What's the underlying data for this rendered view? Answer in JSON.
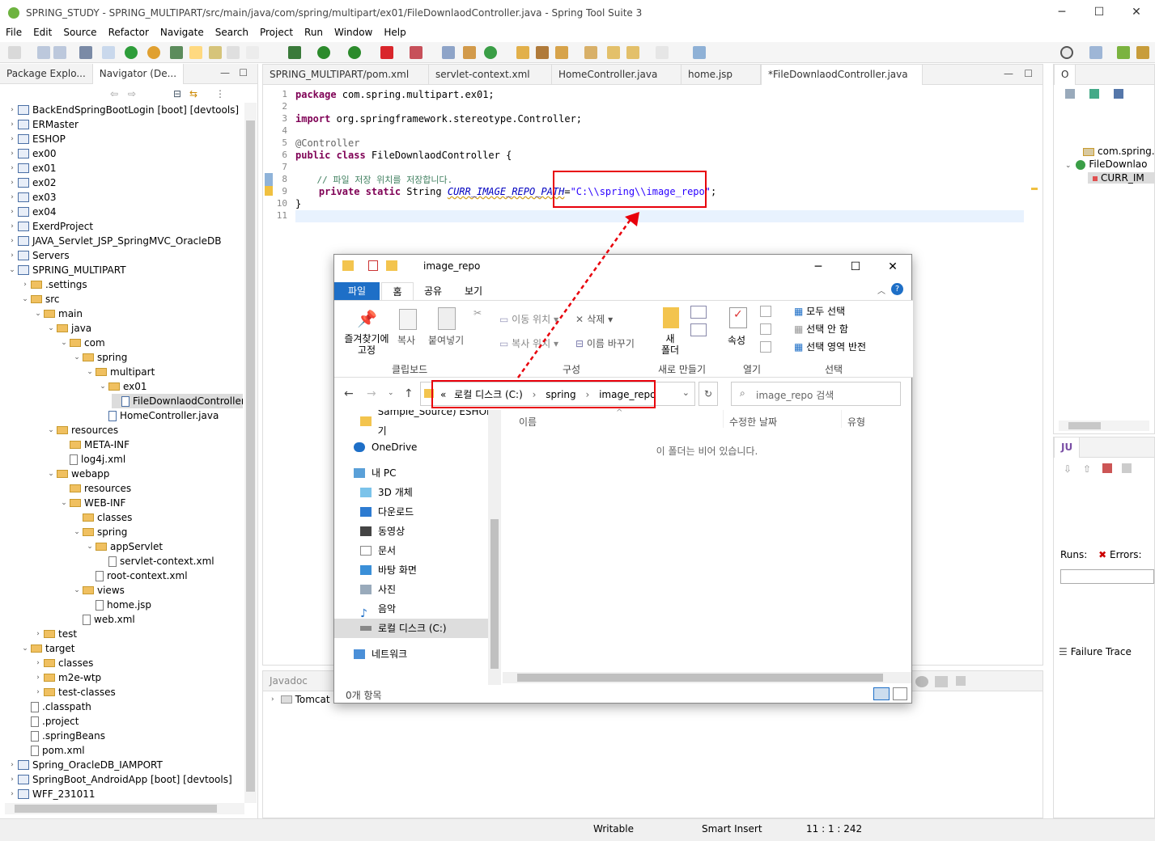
{
  "window": {
    "title": "SPRING_STUDY - SPRING_MULTIPART/src/main/java/com/spring/multipart/ex01/FileDownlaodController.java - Spring Tool Suite 3",
    "min": "─",
    "max": "☐",
    "close": "✕"
  },
  "menu": [
    "File",
    "Edit",
    "Source",
    "Refactor",
    "Navigate",
    "Search",
    "Project",
    "Run",
    "Window",
    "Help"
  ],
  "left_panel": {
    "tabs": [
      "Package Explo...",
      "Navigator (De..."
    ]
  },
  "tree": [
    {
      "l": "BackEndSpringBootLogin [boot] [devtools]",
      "d": 0,
      "t": "proj",
      "tw": "›"
    },
    {
      "l": "ERMaster",
      "d": 0,
      "t": "proj",
      "tw": "›"
    },
    {
      "l": "ESHOP",
      "d": 0,
      "t": "proj",
      "tw": "›"
    },
    {
      "l": "ex00",
      "d": 0,
      "t": "proj",
      "tw": "›"
    },
    {
      "l": "ex01",
      "d": 0,
      "t": "proj",
      "tw": "›"
    },
    {
      "l": "ex02",
      "d": 0,
      "t": "proj",
      "tw": "›"
    },
    {
      "l": "ex03",
      "d": 0,
      "t": "proj",
      "tw": "›"
    },
    {
      "l": "ex04",
      "d": 0,
      "t": "proj",
      "tw": "›"
    },
    {
      "l": "ExerdProject",
      "d": 0,
      "t": "proj",
      "tw": "›"
    },
    {
      "l": "JAVA_Servlet_JSP_SpringMVC_OracleDB",
      "d": 0,
      "t": "proj",
      "tw": "›"
    },
    {
      "l": "Servers",
      "d": 0,
      "t": "proj",
      "tw": "›"
    },
    {
      "l": "SPRING_MULTIPART",
      "d": 0,
      "t": "proj",
      "tw": "⌄"
    },
    {
      "l": ".settings",
      "d": 1,
      "t": "fold",
      "tw": "›"
    },
    {
      "l": "src",
      "d": 1,
      "t": "fold",
      "tw": "⌄"
    },
    {
      "l": "main",
      "d": 2,
      "t": "fold",
      "tw": "⌄"
    },
    {
      "l": "java",
      "d": 3,
      "t": "fold",
      "tw": "⌄"
    },
    {
      "l": "com",
      "d": 4,
      "t": "fold",
      "tw": "⌄"
    },
    {
      "l": "spring",
      "d": 5,
      "t": "fold",
      "tw": "⌄"
    },
    {
      "l": "multipart",
      "d": 6,
      "t": "fold",
      "tw": "⌄"
    },
    {
      "l": "ex01",
      "d": 7,
      "t": "fold",
      "tw": "⌄"
    },
    {
      "l": "FileDownlaodController",
      "d": 8,
      "t": "java",
      "tw": "",
      "sel": true
    },
    {
      "l": "HomeController.java",
      "d": 7,
      "t": "java",
      "tw": ""
    },
    {
      "l": "resources",
      "d": 3,
      "t": "fold",
      "tw": "⌄"
    },
    {
      "l": "META-INF",
      "d": 4,
      "t": "fold",
      "tw": ""
    },
    {
      "l": "log4j.xml",
      "d": 4,
      "t": "xml",
      "tw": ""
    },
    {
      "l": "webapp",
      "d": 3,
      "t": "fold",
      "tw": "⌄"
    },
    {
      "l": "resources",
      "d": 4,
      "t": "fold",
      "tw": ""
    },
    {
      "l": "WEB-INF",
      "d": 4,
      "t": "fold",
      "tw": "⌄"
    },
    {
      "l": "classes",
      "d": 5,
      "t": "fold",
      "tw": ""
    },
    {
      "l": "spring",
      "d": 5,
      "t": "fold",
      "tw": "⌄"
    },
    {
      "l": "appServlet",
      "d": 6,
      "t": "fold",
      "tw": "⌄"
    },
    {
      "l": "servlet-context.xml",
      "d": 7,
      "t": "xml",
      "tw": ""
    },
    {
      "l": "root-context.xml",
      "d": 6,
      "t": "xml",
      "tw": ""
    },
    {
      "l": "views",
      "d": 5,
      "t": "fold",
      "tw": "⌄"
    },
    {
      "l": "home.jsp",
      "d": 6,
      "t": "file",
      "tw": ""
    },
    {
      "l": "web.xml",
      "d": 5,
      "t": "xml",
      "tw": ""
    },
    {
      "l": "test",
      "d": 2,
      "t": "fold",
      "tw": "›"
    },
    {
      "l": "target",
      "d": 1,
      "t": "fold",
      "tw": "⌄"
    },
    {
      "l": "classes",
      "d": 2,
      "t": "fold",
      "tw": "›"
    },
    {
      "l": "m2e-wtp",
      "d": 2,
      "t": "fold",
      "tw": "›"
    },
    {
      "l": "test-classes",
      "d": 2,
      "t": "fold",
      "tw": "›"
    },
    {
      "l": ".classpath",
      "d": 1,
      "t": "xml",
      "tw": ""
    },
    {
      "l": ".project",
      "d": 1,
      "t": "xml",
      "tw": ""
    },
    {
      "l": ".springBeans",
      "d": 1,
      "t": "file",
      "tw": ""
    },
    {
      "l": "pom.xml",
      "d": 1,
      "t": "file",
      "tw": ""
    },
    {
      "l": "Spring_OracleDB_IAMPORT",
      "d": 0,
      "t": "proj",
      "tw": "›"
    },
    {
      "l": "SpringBoot_AndroidApp [boot] [devtools]",
      "d": 0,
      "t": "proj",
      "tw": "›"
    },
    {
      "l": "WFF_231011",
      "d": 0,
      "t": "proj",
      "tw": "›"
    }
  ],
  "editor": {
    "tabs": [
      "SPRING_MULTIPART/pom.xml",
      "servlet-context.xml",
      "HomeController.java",
      "home.jsp",
      "*FileDownlaodController.java"
    ],
    "line_numbers": [
      "1",
      "2",
      "3",
      "4",
      "5",
      "6",
      "7",
      "8",
      "9",
      "10",
      "11"
    ],
    "code": {
      "l1a": "package",
      "l1b": " com.spring.multipart.ex01;",
      "l3a": "import",
      "l3b": " org.springframework.stereotype.Controller;",
      "l5": "@Controller",
      "l6a": "public class",
      "l6b": " FileDownlaodController {",
      "l8": "    // 파일 저장 위치를 저장합니다.",
      "l9a": "    private static",
      "l9b": " String ",
      "l9c": "CURR_IMAGE_REPO_PATH",
      "l9d": "=",
      "l9e": "\"C:\\\\spring\\\\image_repo\"",
      "l9f": ";",
      "l10": "}"
    }
  },
  "bottom": {
    "tabs": [
      "Javadoc"
    ],
    "tree_item": "Tomcat"
  },
  "right_top": {
    "tab": "O",
    "items": [
      "com.spring.r",
      "FileDownlao",
      "CURR_IM"
    ]
  },
  "right_bottom": {
    "tab": "JU",
    "runs_label": "Runs:",
    "errors_label": "Errors:",
    "failure_trace": "Failure Trace"
  },
  "status": {
    "writable": "Writable",
    "insert": "Smart Insert",
    "position": "11 : 1 : 242"
  },
  "explorer": {
    "title": "image_repo",
    "ribbon_tabs": [
      "파일",
      "홈",
      "공유",
      "보기"
    ],
    "ribbon": {
      "pin": "즐겨찾기에\n고정",
      "copy": "복사",
      "paste": "붙여넣기",
      "move_to": "이동 위치",
      "copy_to": "복사 위치",
      "delete": "삭제",
      "rename": "이름 바꾸기",
      "new_folder": "새\n폴더",
      "properties": "속성",
      "select_all": "모두 선택",
      "select_none": "선택 안 함",
      "invert": "선택 영역 반전",
      "g_clipboard": "클립보드",
      "g_organize": "구성",
      "g_new": "새로 만들기",
      "g_open": "열기",
      "g_select": "선택"
    },
    "address": {
      "prefix": "«",
      "parts": [
        "로컬 디스크 (C:)",
        "spring",
        "image_repo"
      ]
    },
    "search_placeholder": "image_repo 검색",
    "nav": [
      "Sample_Source) ESHOP 기",
      "OneDrive",
      "내 PC",
      "3D 개체",
      "다운로드",
      "동영상",
      "문서",
      "바탕 화면",
      "사진",
      "음악",
      "로컬 디스크 (C:)",
      "네트워크"
    ],
    "columns": [
      "이름",
      "수정한 날짜",
      "유형"
    ],
    "empty": "이 폴더는 비어 있습니다.",
    "count": "0개 항목"
  },
  "colors": {
    "accent": "#1e6fc7",
    "annotation": "#e8000b"
  }
}
